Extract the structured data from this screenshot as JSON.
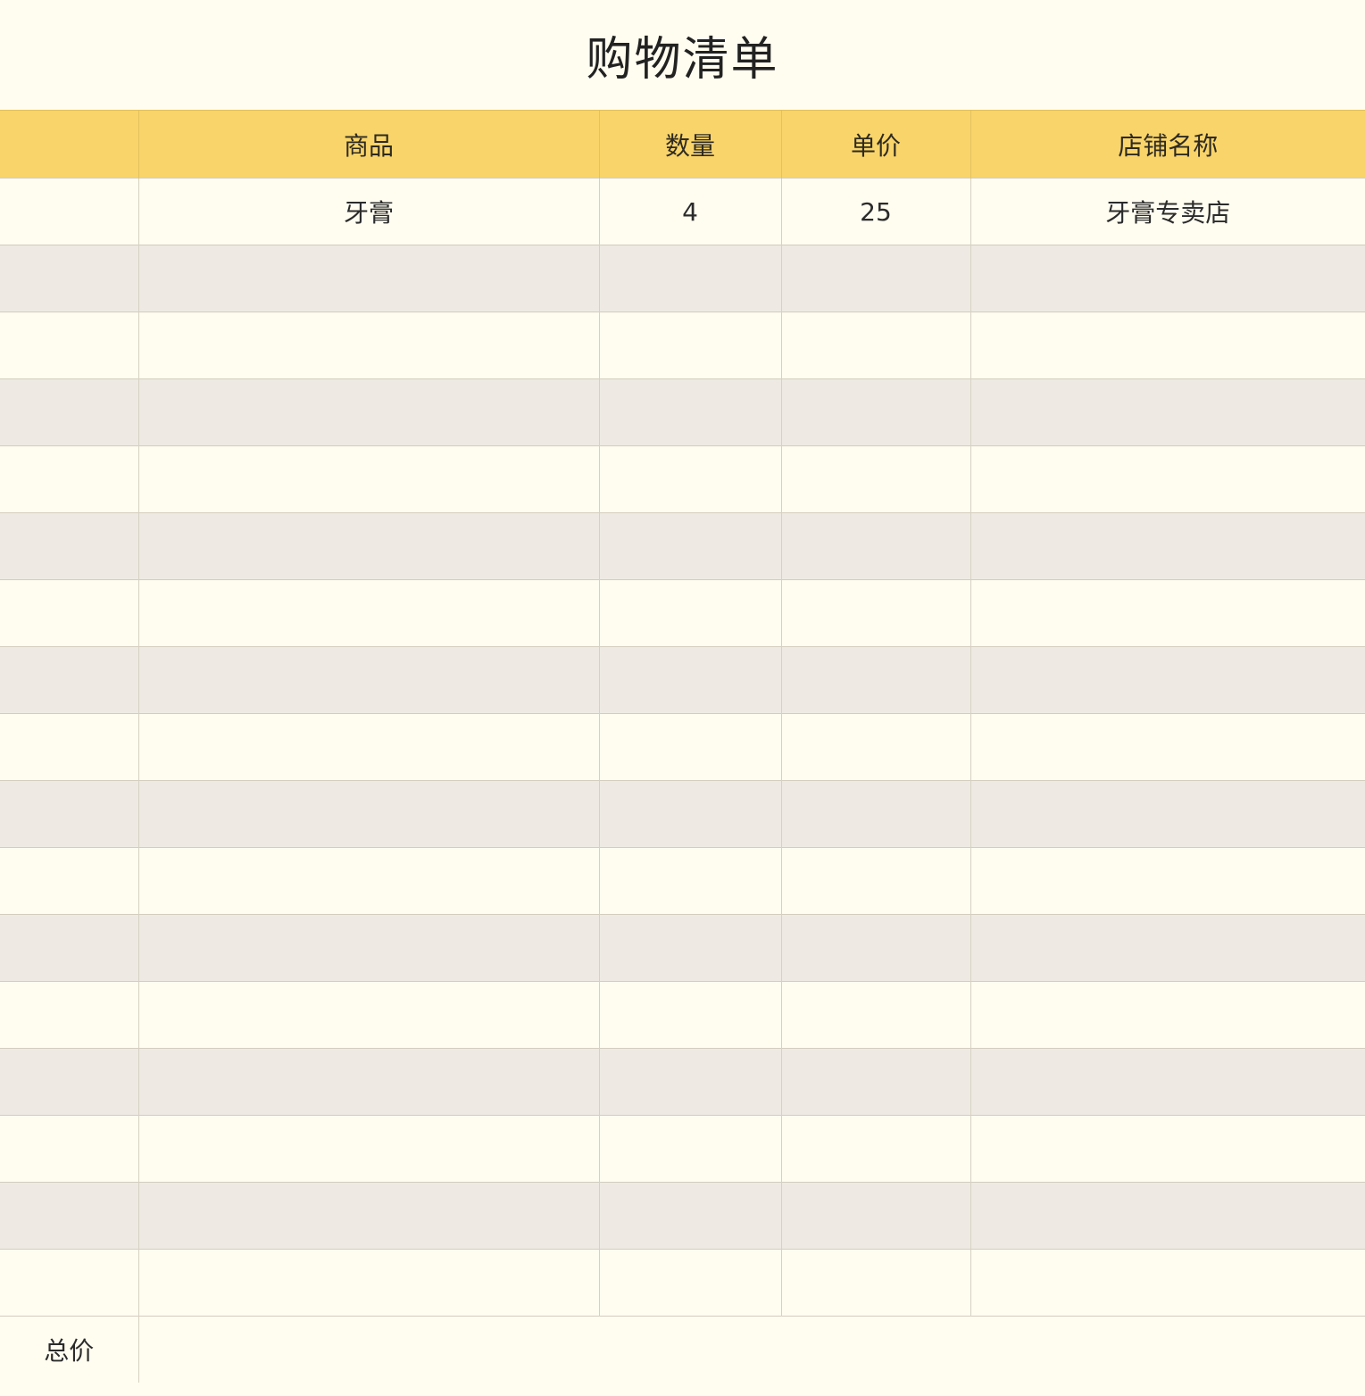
{
  "title": "购物清单",
  "table": {
    "headers": [
      "",
      "商品",
      "数量",
      "单价",
      "店铺名称"
    ],
    "rows": [
      [
        "",
        "牙膏",
        "4",
        "25",
        "牙膏专卖店"
      ],
      [
        "",
        "",
        "",
        "",
        ""
      ],
      [
        "",
        "",
        "",
        "",
        ""
      ],
      [
        "",
        "",
        "",
        "",
        ""
      ],
      [
        "",
        "",
        "",
        "",
        ""
      ],
      [
        "",
        "",
        "",
        "",
        ""
      ],
      [
        "",
        "",
        "",
        "",
        ""
      ],
      [
        "",
        "",
        "",
        "",
        ""
      ],
      [
        "",
        "",
        "",
        "",
        ""
      ],
      [
        "",
        "",
        "",
        "",
        ""
      ],
      [
        "",
        "",
        "",
        "",
        ""
      ],
      [
        "",
        "",
        "",
        "",
        ""
      ],
      [
        "",
        "",
        "",
        "",
        ""
      ],
      [
        "",
        "",
        "",
        "",
        ""
      ],
      [
        "",
        "",
        "",
        "",
        ""
      ],
      [
        "",
        "",
        "",
        "",
        ""
      ],
      [
        "",
        "",
        "",
        "",
        ""
      ]
    ]
  },
  "footer": {
    "total_label": "总价",
    "total_value": ""
  },
  "colors": {
    "background": "#fffcf0",
    "header": "#f8d46a",
    "stripe": "#eeeae3"
  }
}
